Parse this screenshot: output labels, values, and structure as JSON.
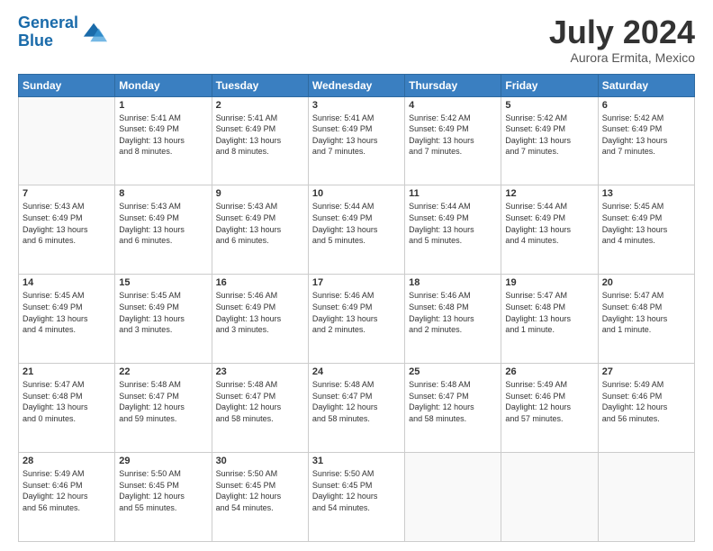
{
  "header": {
    "logo_line1": "General",
    "logo_line2": "Blue",
    "month": "July 2024",
    "location": "Aurora Ermita, Mexico"
  },
  "days_of_week": [
    "Sunday",
    "Monday",
    "Tuesday",
    "Wednesday",
    "Thursday",
    "Friday",
    "Saturday"
  ],
  "weeks": [
    [
      {
        "day": "",
        "info": ""
      },
      {
        "day": "1",
        "info": "Sunrise: 5:41 AM\nSunset: 6:49 PM\nDaylight: 13 hours\nand 8 minutes."
      },
      {
        "day": "2",
        "info": "Sunrise: 5:41 AM\nSunset: 6:49 PM\nDaylight: 13 hours\nand 8 minutes."
      },
      {
        "day": "3",
        "info": "Sunrise: 5:41 AM\nSunset: 6:49 PM\nDaylight: 13 hours\nand 7 minutes."
      },
      {
        "day": "4",
        "info": "Sunrise: 5:42 AM\nSunset: 6:49 PM\nDaylight: 13 hours\nand 7 minutes."
      },
      {
        "day": "5",
        "info": "Sunrise: 5:42 AM\nSunset: 6:49 PM\nDaylight: 13 hours\nand 7 minutes."
      },
      {
        "day": "6",
        "info": "Sunrise: 5:42 AM\nSunset: 6:49 PM\nDaylight: 13 hours\nand 7 minutes."
      }
    ],
    [
      {
        "day": "7",
        "info": "Sunrise: 5:43 AM\nSunset: 6:49 PM\nDaylight: 13 hours\nand 6 minutes."
      },
      {
        "day": "8",
        "info": "Sunrise: 5:43 AM\nSunset: 6:49 PM\nDaylight: 13 hours\nand 6 minutes."
      },
      {
        "day": "9",
        "info": "Sunrise: 5:43 AM\nSunset: 6:49 PM\nDaylight: 13 hours\nand 6 minutes."
      },
      {
        "day": "10",
        "info": "Sunrise: 5:44 AM\nSunset: 6:49 PM\nDaylight: 13 hours\nand 5 minutes."
      },
      {
        "day": "11",
        "info": "Sunrise: 5:44 AM\nSunset: 6:49 PM\nDaylight: 13 hours\nand 5 minutes."
      },
      {
        "day": "12",
        "info": "Sunrise: 5:44 AM\nSunset: 6:49 PM\nDaylight: 13 hours\nand 4 minutes."
      },
      {
        "day": "13",
        "info": "Sunrise: 5:45 AM\nSunset: 6:49 PM\nDaylight: 13 hours\nand 4 minutes."
      }
    ],
    [
      {
        "day": "14",
        "info": "Sunrise: 5:45 AM\nSunset: 6:49 PM\nDaylight: 13 hours\nand 4 minutes."
      },
      {
        "day": "15",
        "info": "Sunrise: 5:45 AM\nSunset: 6:49 PM\nDaylight: 13 hours\nand 3 minutes."
      },
      {
        "day": "16",
        "info": "Sunrise: 5:46 AM\nSunset: 6:49 PM\nDaylight: 13 hours\nand 3 minutes."
      },
      {
        "day": "17",
        "info": "Sunrise: 5:46 AM\nSunset: 6:49 PM\nDaylight: 13 hours\nand 2 minutes."
      },
      {
        "day": "18",
        "info": "Sunrise: 5:46 AM\nSunset: 6:48 PM\nDaylight: 13 hours\nand 2 minutes."
      },
      {
        "day": "19",
        "info": "Sunrise: 5:47 AM\nSunset: 6:48 PM\nDaylight: 13 hours\nand 1 minute."
      },
      {
        "day": "20",
        "info": "Sunrise: 5:47 AM\nSunset: 6:48 PM\nDaylight: 13 hours\nand 1 minute."
      }
    ],
    [
      {
        "day": "21",
        "info": "Sunrise: 5:47 AM\nSunset: 6:48 PM\nDaylight: 13 hours\nand 0 minutes."
      },
      {
        "day": "22",
        "info": "Sunrise: 5:48 AM\nSunset: 6:47 PM\nDaylight: 12 hours\nand 59 minutes."
      },
      {
        "day": "23",
        "info": "Sunrise: 5:48 AM\nSunset: 6:47 PM\nDaylight: 12 hours\nand 58 minutes."
      },
      {
        "day": "24",
        "info": "Sunrise: 5:48 AM\nSunset: 6:47 PM\nDaylight: 12 hours\nand 58 minutes."
      },
      {
        "day": "25",
        "info": "Sunrise: 5:48 AM\nSunset: 6:47 PM\nDaylight: 12 hours\nand 58 minutes."
      },
      {
        "day": "26",
        "info": "Sunrise: 5:49 AM\nSunset: 6:46 PM\nDaylight: 12 hours\nand 57 minutes."
      },
      {
        "day": "27",
        "info": "Sunrise: 5:49 AM\nSunset: 6:46 PM\nDaylight: 12 hours\nand 56 minutes."
      }
    ],
    [
      {
        "day": "28",
        "info": "Sunrise: 5:49 AM\nSunset: 6:46 PM\nDaylight: 12 hours\nand 56 minutes."
      },
      {
        "day": "29",
        "info": "Sunrise: 5:50 AM\nSunset: 6:45 PM\nDaylight: 12 hours\nand 55 minutes."
      },
      {
        "day": "30",
        "info": "Sunrise: 5:50 AM\nSunset: 6:45 PM\nDaylight: 12 hours\nand 54 minutes."
      },
      {
        "day": "31",
        "info": "Sunrise: 5:50 AM\nSunset: 6:45 PM\nDaylight: 12 hours\nand 54 minutes."
      },
      {
        "day": "",
        "info": ""
      },
      {
        "day": "",
        "info": ""
      },
      {
        "day": "",
        "info": ""
      }
    ]
  ]
}
